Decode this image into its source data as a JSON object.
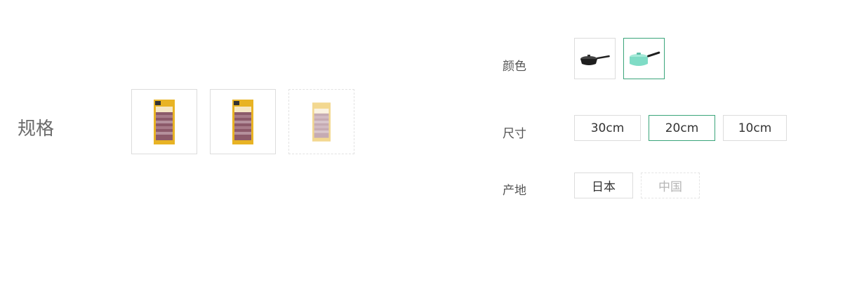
{
  "left": {
    "label": "规格",
    "items": [
      {
        "name": "spec-1",
        "state": "normal"
      },
      {
        "name": "spec-2",
        "state": "normal"
      },
      {
        "name": "spec-3",
        "state": "disabled"
      }
    ]
  },
  "right": {
    "color": {
      "label": "颜色",
      "options": [
        {
          "name": "black-pan",
          "state": "normal",
          "color": "#222222"
        },
        {
          "name": "mint-pan",
          "state": "selected",
          "color": "#7fdcc6"
        }
      ]
    },
    "size": {
      "label": "尺寸",
      "options": [
        {
          "label": "30cm",
          "state": "normal"
        },
        {
          "label": "20cm",
          "state": "selected"
        },
        {
          "label": "10cm",
          "state": "normal"
        }
      ]
    },
    "origin": {
      "label": "产地",
      "options": [
        {
          "label": "日本",
          "state": "normal"
        },
        {
          "label": "中国",
          "state": "disabled"
        }
      ]
    }
  },
  "colors": {
    "accent": "#3aa57a",
    "border": "#dcdcdc",
    "disabled_text": "#b5b5b5"
  }
}
